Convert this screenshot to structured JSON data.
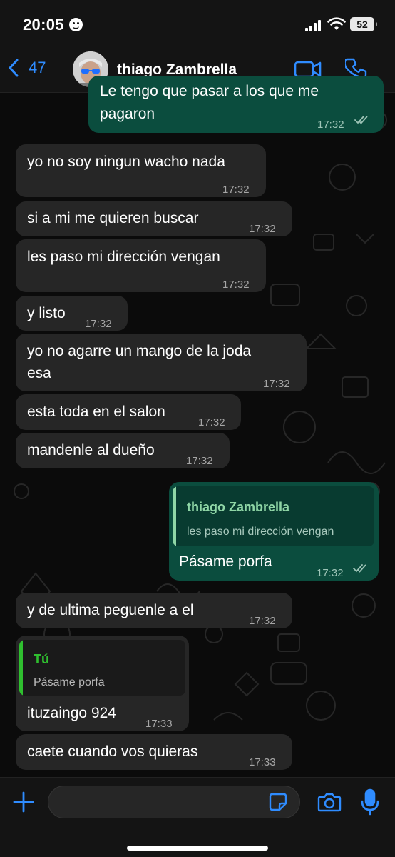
{
  "status_bar": {
    "time": "20:05",
    "battery": "52"
  },
  "header": {
    "back_count": "47",
    "contact_name": "thiago Zambrella"
  },
  "messages": [
    {
      "dir": "out",
      "text_lines": [
        "Le tengo que pasar a los que me",
        "pagaron"
      ],
      "time": "17:32",
      "read": true
    },
    {
      "dir": "in",
      "text": "yo no soy ningun wacho nada",
      "time": "17:32"
    },
    {
      "dir": "in",
      "text": "si a mi me quieren buscar",
      "time": "17:32"
    },
    {
      "dir": "in",
      "text": "les paso mi dirección vengan",
      "time": "17:32"
    },
    {
      "dir": "in",
      "text": "y listo",
      "time": "17:32"
    },
    {
      "dir": "in",
      "text_lines": [
        "yo no agarre un mango de la joda",
        "esa"
      ],
      "time": "17:32"
    },
    {
      "dir": "in",
      "text": "esta toda en el salon",
      "time": "17:32"
    },
    {
      "dir": "in",
      "text": "mandenle al dueño",
      "time": "17:32"
    },
    {
      "dir": "out",
      "quote": {
        "author": "thiago Zambrella",
        "text": "les paso mi dirección vengan"
      },
      "text": "Pásame porfa",
      "time": "17:32",
      "read": true
    },
    {
      "dir": "in",
      "text": "y de ultima peguenle a el",
      "time": "17:32"
    },
    {
      "dir": "in",
      "quote": {
        "author": "Tú",
        "text": "Pásame porfa"
      },
      "text": "ituzaingo 924",
      "time": "17:33"
    },
    {
      "dir": "in",
      "text": "caete cuando vos quieras",
      "time": "17:33"
    }
  ],
  "input": {
    "placeholder": "",
    "value": ""
  },
  "colors": {
    "accent_blue": "#2f8cff",
    "incoming_bubble": "#262626",
    "outgoing_bubble": "#0b4d3e",
    "quote_self": "#2fbf2f",
    "quote_contact": "#8fd6a6"
  },
  "icons": {
    "back": "chevron-left-icon",
    "video": "video-camera-icon",
    "call": "phone-icon",
    "plus": "plus-icon",
    "sticker": "sticker-icon",
    "camera": "camera-icon",
    "mic": "microphone-icon",
    "read": "double-check-icon"
  }
}
